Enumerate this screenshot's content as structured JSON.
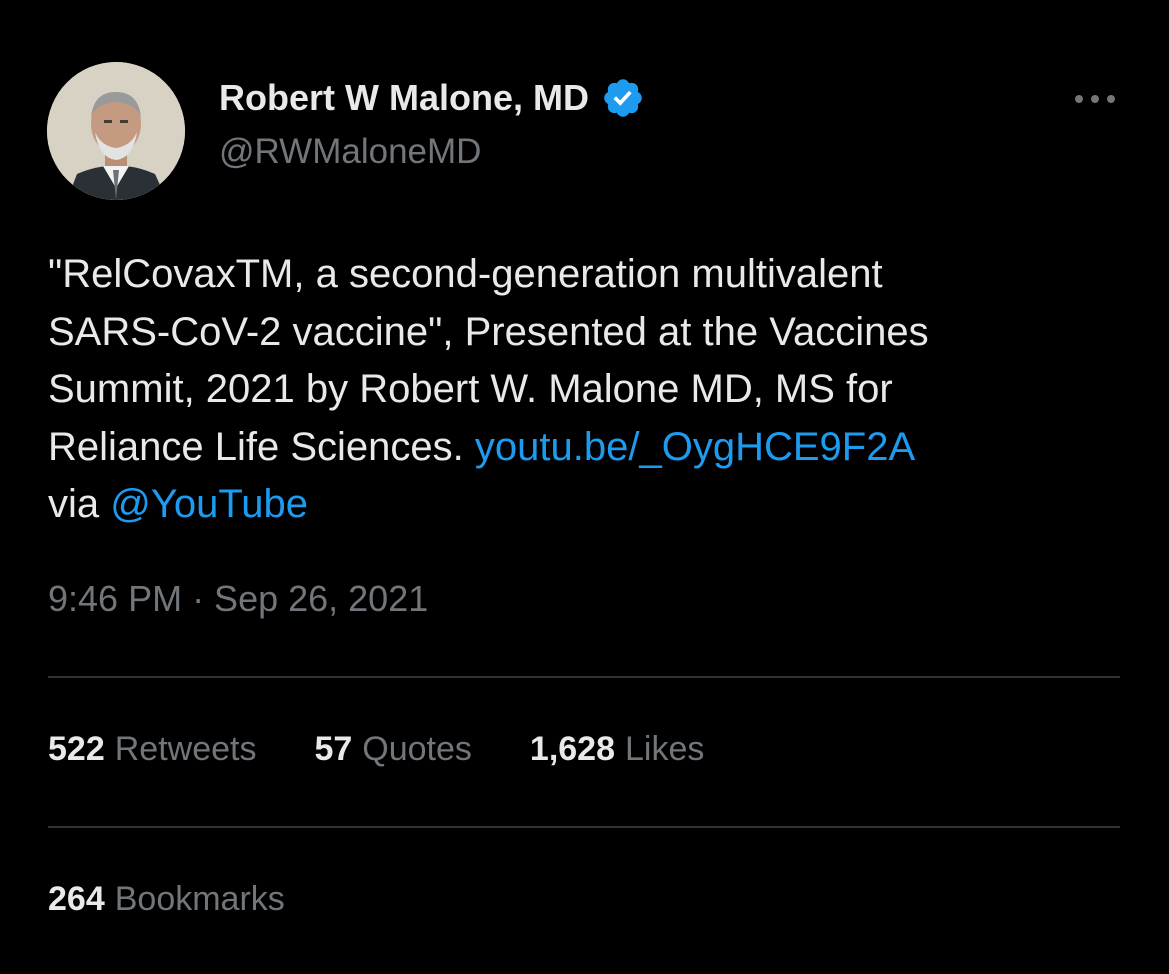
{
  "author": {
    "display_name": "Robert W Malone, MD",
    "handle": "@RWMaloneMD",
    "verified": true,
    "verified_color": "#1d9bf0"
  },
  "tweet": {
    "lines": [
      "\"RelCovaxTM, a second-generation multivalent",
      "SARS-CoV-2 vaccine\", Presented at the Vaccines",
      "Summit, 2021 by Robert W. Malone MD, MS for"
    ],
    "line4_text": "Reliance Life Sciences. ",
    "link_url_text": "youtu.be/_OygHCE9F2A",
    "line5_text": "via ",
    "mention": "@YouTube",
    "timestamp": "9:46 PM · Sep 26, 2021"
  },
  "stats": {
    "retweets": {
      "count": "522",
      "label": "Retweets"
    },
    "quotes": {
      "count": "57",
      "label": "Quotes"
    },
    "likes": {
      "count": "1,628",
      "label": "Likes"
    },
    "bookmarks": {
      "count": "264",
      "label": "Bookmarks"
    }
  },
  "icons": {
    "more": "more-horizontal-icon",
    "verified": "verified-badge-icon"
  },
  "colors": {
    "background": "#000000",
    "text": "#e7e9ea",
    "secondary_text": "#71767b",
    "link": "#1d9bf0",
    "divider": "#2f3336"
  }
}
